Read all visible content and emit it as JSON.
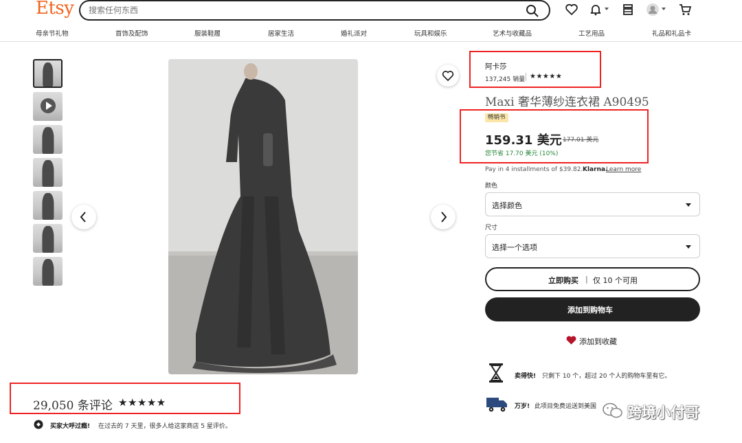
{
  "header": {
    "logo": "Etsy",
    "search_placeholder": "搜索任何东西"
  },
  "categories": [
    "母亲节礼物",
    "首饰及配饰",
    "服装鞋履",
    "居家生活",
    "婚礼派对",
    "玩具和娱乐",
    "艺术与收藏品",
    "工艺用品",
    "礼品和礼品卡"
  ],
  "gallery": {
    "thumbnails": [
      "thumb-1",
      "video",
      "thumb-3",
      "thumb-4",
      "thumb-5",
      "thumb-6",
      "thumb-7"
    ],
    "selected_index": 0
  },
  "reviews": {
    "count_text": "29,050 条评论",
    "stars": "★★★★★",
    "note_bold": "买家大呼过瘾!",
    "note_text": "在过去的 7 天里，很多人给这家商店 5 星评价。"
  },
  "shop": {
    "name": "阿卡莎",
    "sales": "137,245 销量",
    "stars": "★★★★★"
  },
  "product": {
    "title": "Maxi 奢华薄纱连衣裙 A90495",
    "badge": "畅销书",
    "price": "159.31 美元",
    "original_price": "177.01 美元",
    "savings": "您节省 17.70 美元 (10%)",
    "installments_text": "Pay in 4 installments of $39.82.",
    "klarna": "Klarna.",
    "learn_more": "Learn more"
  },
  "options": {
    "color_label": "颜色",
    "color_value": "选择颜色",
    "size_label": "尺寸",
    "size_value": "选择一个选项"
  },
  "actions": {
    "buy_now": "立即购买",
    "buy_sep": "|",
    "availability": "仅 10 个可用",
    "add_to_cart": "添加到购物车",
    "add_to_favorites": "添加到收藏"
  },
  "highlights": [
    {
      "bold": "卖得快!",
      "text": "只剩下 10 个，超过 20 个人的购物车里有它。"
    },
    {
      "bold": "万岁!",
      "text": "此项目免费运送到美国"
    }
  ],
  "watermark": "跨境小付哥",
  "colors": {
    "brand": "#f1641e",
    "price_savings": "#258635",
    "highlight_red": "#e22222",
    "heart": "#b5142b"
  }
}
